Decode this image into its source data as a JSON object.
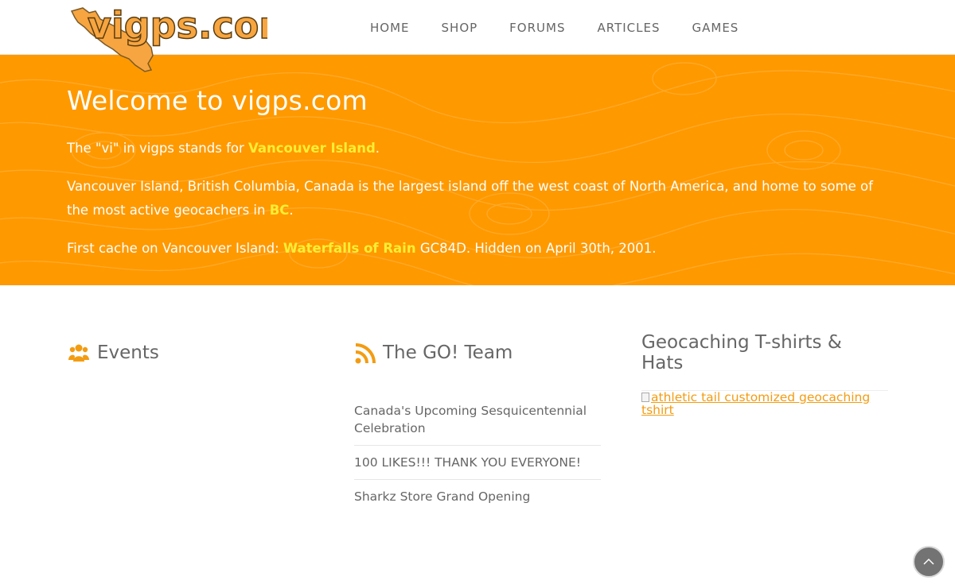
{
  "header": {
    "logo_text": "vigps.com",
    "nav": [
      "HOME",
      "SHOP",
      "FORUMS",
      "ARTICLES",
      "GAMES"
    ]
  },
  "hero": {
    "title": "Welcome to vigps.com",
    "p1_prefix": "The \"vi\" in vigps stands for ",
    "p1_link": "Vancouver Island",
    "p1_suffix": ".",
    "p2_prefix": "Vancouver Island, British Columbia, Canada is the largest island off the west coast of North America, and home to some of the most active geocachers in ",
    "p2_link": "BC",
    "p2_suffix": ".",
    "p3_prefix": "First cache on Vancouver Island: ",
    "p3_link": "Waterfalls of Rain",
    "p3_suffix": " GC84D. Hidden on April 30th, 2001."
  },
  "events": {
    "title": "Events",
    "icon": "users-icon"
  },
  "team": {
    "title": "The GO! Team",
    "icon": "rss-icon",
    "items": [
      "Canada's Upcoming Sesquicentennial Celebration",
      "100 LIKES!!! THANK YOU EVERYONE!",
      "Sharkz Store Grand Opening"
    ]
  },
  "shop": {
    "title": "Geocaching T-shirts & Hats",
    "image_alt": "athletic tail customized geocaching tshirt"
  },
  "colors": {
    "accent": "#ff9900",
    "link_highlight": "#ffee33",
    "nav_text": "#666666"
  }
}
